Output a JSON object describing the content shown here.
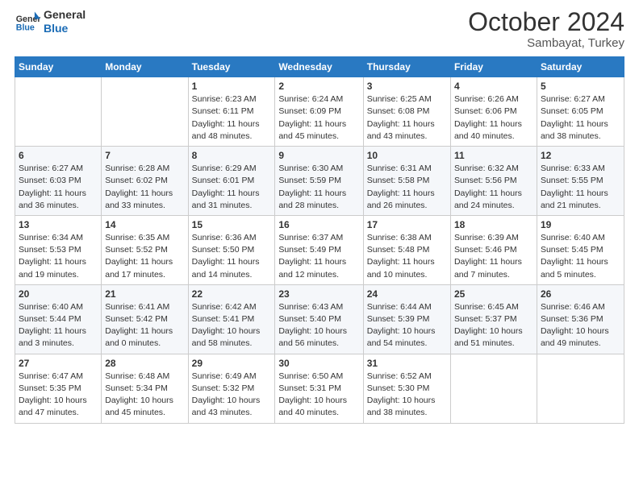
{
  "logo": {
    "line1": "General",
    "line2": "Blue"
  },
  "header": {
    "month": "October 2024",
    "location": "Sambayat, Turkey"
  },
  "days_of_week": [
    "Sunday",
    "Monday",
    "Tuesday",
    "Wednesday",
    "Thursday",
    "Friday",
    "Saturday"
  ],
  "weeks": [
    [
      {
        "day": "",
        "info": ""
      },
      {
        "day": "",
        "info": ""
      },
      {
        "day": "1",
        "info": "Sunrise: 6:23 AM\nSunset: 6:11 PM\nDaylight: 11 hours and 48 minutes."
      },
      {
        "day": "2",
        "info": "Sunrise: 6:24 AM\nSunset: 6:09 PM\nDaylight: 11 hours and 45 minutes."
      },
      {
        "day": "3",
        "info": "Sunrise: 6:25 AM\nSunset: 6:08 PM\nDaylight: 11 hours and 43 minutes."
      },
      {
        "day": "4",
        "info": "Sunrise: 6:26 AM\nSunset: 6:06 PM\nDaylight: 11 hours and 40 minutes."
      },
      {
        "day": "5",
        "info": "Sunrise: 6:27 AM\nSunset: 6:05 PM\nDaylight: 11 hours and 38 minutes."
      }
    ],
    [
      {
        "day": "6",
        "info": "Sunrise: 6:27 AM\nSunset: 6:03 PM\nDaylight: 11 hours and 36 minutes."
      },
      {
        "day": "7",
        "info": "Sunrise: 6:28 AM\nSunset: 6:02 PM\nDaylight: 11 hours and 33 minutes."
      },
      {
        "day": "8",
        "info": "Sunrise: 6:29 AM\nSunset: 6:01 PM\nDaylight: 11 hours and 31 minutes."
      },
      {
        "day": "9",
        "info": "Sunrise: 6:30 AM\nSunset: 5:59 PM\nDaylight: 11 hours and 28 minutes."
      },
      {
        "day": "10",
        "info": "Sunrise: 6:31 AM\nSunset: 5:58 PM\nDaylight: 11 hours and 26 minutes."
      },
      {
        "day": "11",
        "info": "Sunrise: 6:32 AM\nSunset: 5:56 PM\nDaylight: 11 hours and 24 minutes."
      },
      {
        "day": "12",
        "info": "Sunrise: 6:33 AM\nSunset: 5:55 PM\nDaylight: 11 hours and 21 minutes."
      }
    ],
    [
      {
        "day": "13",
        "info": "Sunrise: 6:34 AM\nSunset: 5:53 PM\nDaylight: 11 hours and 19 minutes."
      },
      {
        "day": "14",
        "info": "Sunrise: 6:35 AM\nSunset: 5:52 PM\nDaylight: 11 hours and 17 minutes."
      },
      {
        "day": "15",
        "info": "Sunrise: 6:36 AM\nSunset: 5:50 PM\nDaylight: 11 hours and 14 minutes."
      },
      {
        "day": "16",
        "info": "Sunrise: 6:37 AM\nSunset: 5:49 PM\nDaylight: 11 hours and 12 minutes."
      },
      {
        "day": "17",
        "info": "Sunrise: 6:38 AM\nSunset: 5:48 PM\nDaylight: 11 hours and 10 minutes."
      },
      {
        "day": "18",
        "info": "Sunrise: 6:39 AM\nSunset: 5:46 PM\nDaylight: 11 hours and 7 minutes."
      },
      {
        "day": "19",
        "info": "Sunrise: 6:40 AM\nSunset: 5:45 PM\nDaylight: 11 hours and 5 minutes."
      }
    ],
    [
      {
        "day": "20",
        "info": "Sunrise: 6:40 AM\nSunset: 5:44 PM\nDaylight: 11 hours and 3 minutes."
      },
      {
        "day": "21",
        "info": "Sunrise: 6:41 AM\nSunset: 5:42 PM\nDaylight: 11 hours and 0 minutes."
      },
      {
        "day": "22",
        "info": "Sunrise: 6:42 AM\nSunset: 5:41 PM\nDaylight: 10 hours and 58 minutes."
      },
      {
        "day": "23",
        "info": "Sunrise: 6:43 AM\nSunset: 5:40 PM\nDaylight: 10 hours and 56 minutes."
      },
      {
        "day": "24",
        "info": "Sunrise: 6:44 AM\nSunset: 5:39 PM\nDaylight: 10 hours and 54 minutes."
      },
      {
        "day": "25",
        "info": "Sunrise: 6:45 AM\nSunset: 5:37 PM\nDaylight: 10 hours and 51 minutes."
      },
      {
        "day": "26",
        "info": "Sunrise: 6:46 AM\nSunset: 5:36 PM\nDaylight: 10 hours and 49 minutes."
      }
    ],
    [
      {
        "day": "27",
        "info": "Sunrise: 6:47 AM\nSunset: 5:35 PM\nDaylight: 10 hours and 47 minutes."
      },
      {
        "day": "28",
        "info": "Sunrise: 6:48 AM\nSunset: 5:34 PM\nDaylight: 10 hours and 45 minutes."
      },
      {
        "day": "29",
        "info": "Sunrise: 6:49 AM\nSunset: 5:32 PM\nDaylight: 10 hours and 43 minutes."
      },
      {
        "day": "30",
        "info": "Sunrise: 6:50 AM\nSunset: 5:31 PM\nDaylight: 10 hours and 40 minutes."
      },
      {
        "day": "31",
        "info": "Sunrise: 6:52 AM\nSunset: 5:30 PM\nDaylight: 10 hours and 38 minutes."
      },
      {
        "day": "",
        "info": ""
      },
      {
        "day": "",
        "info": ""
      }
    ]
  ]
}
